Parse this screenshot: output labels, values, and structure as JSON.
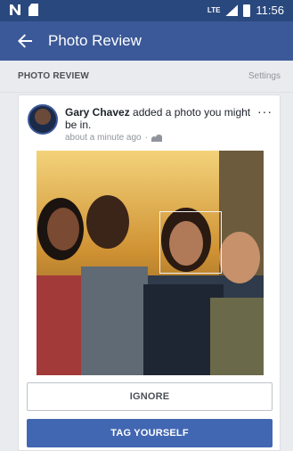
{
  "status_bar": {
    "time": "11:56",
    "network": "LTE"
  },
  "app_bar": {
    "title": "Photo Review"
  },
  "section": {
    "title": "PHOTO REVIEW",
    "settings_label": "Settings"
  },
  "post": {
    "author": "Gary Chavez",
    "action_text": " added a photo you might be in.",
    "time": "about a minute ago",
    "audience_icon": "friends-icon",
    "more_icon": "more-icon"
  },
  "actions": {
    "ignore_label": "IGNORE",
    "tag_label": "TAG YOURSELF"
  },
  "colors": {
    "status_bar": "#29487d",
    "app_bar": "#3b5998",
    "primary_button": "#4267b2",
    "background": "#e9ebee"
  }
}
